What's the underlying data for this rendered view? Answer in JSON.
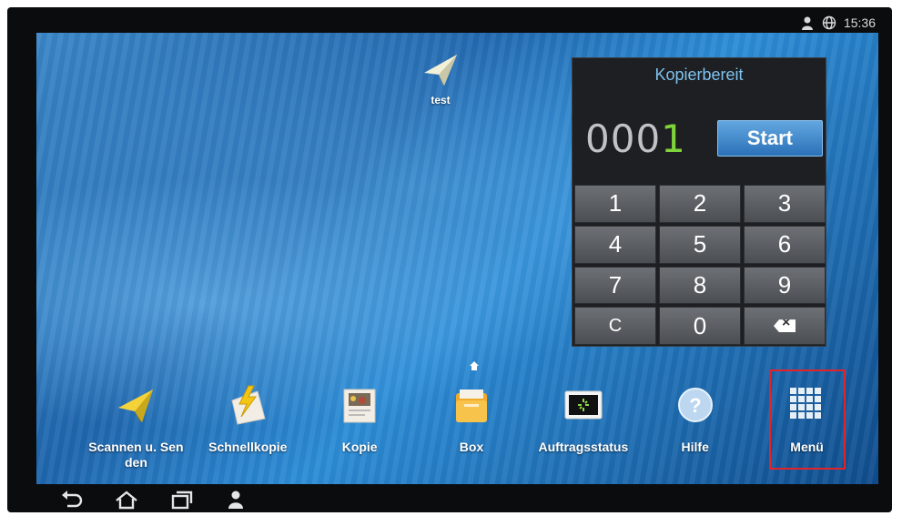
{
  "status_bar": {
    "time": "15:36"
  },
  "desktop_shortcut": {
    "label": "test"
  },
  "copy_widget": {
    "status": "Kopierbereit",
    "counter_digits_inactive": "000",
    "counter_digit_active": "1",
    "start_label": "Start",
    "keys": [
      "1",
      "2",
      "3",
      "4",
      "5",
      "6",
      "7",
      "8",
      "9",
      "C",
      "0"
    ]
  },
  "dock": {
    "apps": [
      {
        "label": "Scannen u. Senden"
      },
      {
        "label": "Schnellkopie"
      },
      {
        "label": "Kopie"
      },
      {
        "label": "Box"
      },
      {
        "label": "Auftragsstatus"
      },
      {
        "label": "Hilfe"
      },
      {
        "label": "Menü"
      }
    ]
  },
  "colors": {
    "accent": "#2b71b8",
    "highlight": "#e3232a",
    "counter_active": "#7ed43a"
  }
}
